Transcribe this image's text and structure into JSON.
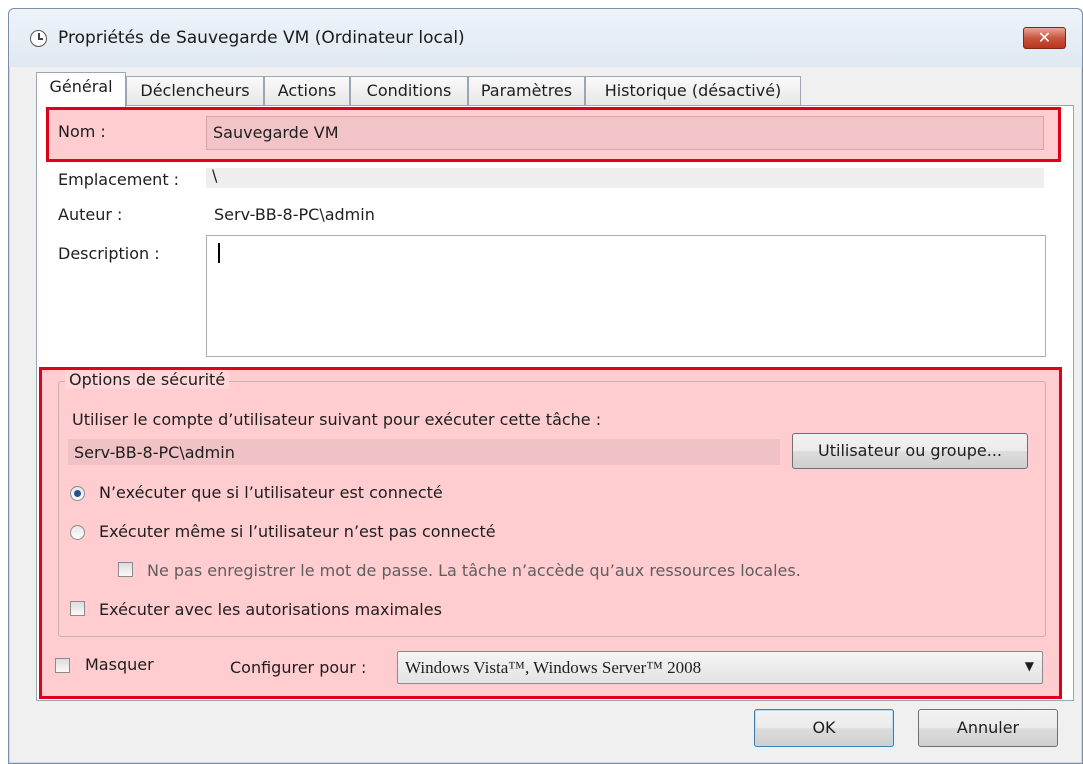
{
  "window": {
    "title": "Propriétés de Sauvegarde VM (Ordinateur local)",
    "close_label": "✕"
  },
  "tabs": [
    "Général",
    "Déclencheurs",
    "Actions",
    "Conditions",
    "Paramètres",
    "Historique (désactivé)"
  ],
  "general": {
    "name_label": "Nom :",
    "name_value": "Sauvegarde VM",
    "location_label": "Emplacement :",
    "location_value": "\\",
    "author_label": "Auteur :",
    "author_value": "Serv-BB-8-PC\\admin",
    "description_label": "Description :",
    "description_value": ""
  },
  "security": {
    "group_title": "Options de sécurité",
    "account_prompt": "Utiliser le compte d’utilisateur suivant pour exécuter cette tâche :",
    "account_value": "Serv-BB-8-PC\\admin",
    "user_group_button": "Utilisateur ou groupe...",
    "radio_logged_on": "N’exécuter que si l’utilisateur est connecté",
    "radio_always": "Exécuter même si l’utilisateur n’est pas connecté",
    "no_store_password": "Ne pas enregistrer le mot de passe. La tâche n’accède qu’aux ressources locales.",
    "highest_privileges": "Exécuter avec les autorisations maximales",
    "selected_radio": "logged_on"
  },
  "bottom": {
    "hidden_label": "Masquer",
    "configure_label": "Configurer pour :",
    "configure_value": "Windows Vista™, Windows Server™ 2008"
  },
  "footer": {
    "ok_label": "OK",
    "cancel_label": "Annuler"
  },
  "colors": {
    "highlight_border": "#e0001a",
    "highlight_fill": "#ffb3ba"
  }
}
